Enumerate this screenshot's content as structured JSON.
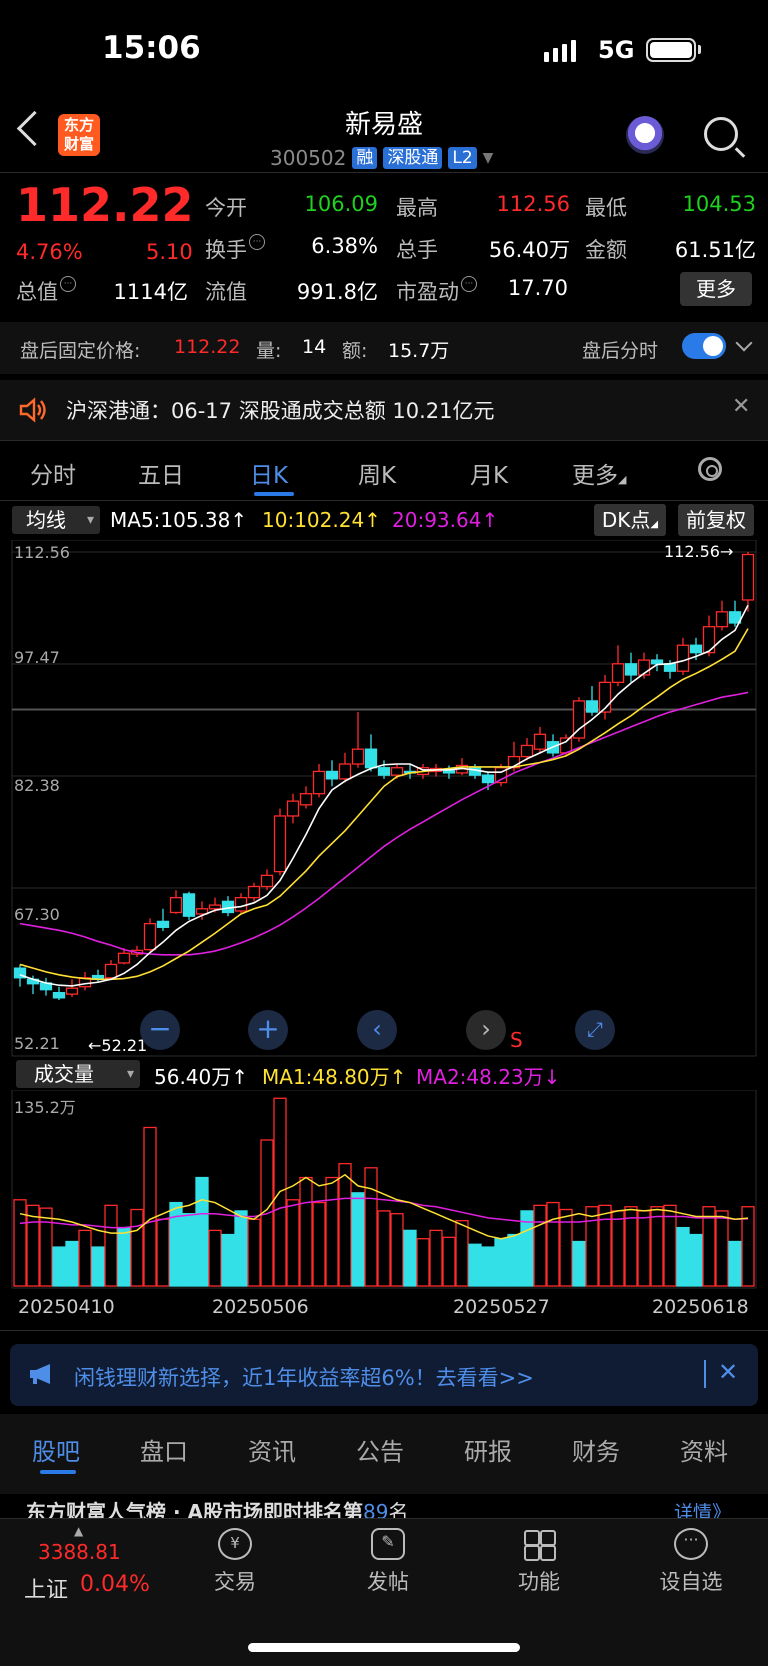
{
  "status_bar": {
    "time": "15:06",
    "network": "5G"
  },
  "header": {
    "logo_text": "东方财富",
    "stock_name": "新易盛",
    "stock_code": "300502",
    "tags": [
      "融",
      "深股通",
      "L2"
    ]
  },
  "quote": {
    "price": "112.22",
    "change_pct": "4.76%",
    "change": "5.10",
    "rows": [
      [
        {
          "label": "今开",
          "value": "106.09",
          "color": "#1fd11f"
        },
        {
          "label": "最高",
          "value": "112.56",
          "color": "#ff2a2a"
        },
        {
          "label": "最低",
          "value": "104.53",
          "color": "#1fd11f"
        }
      ],
      [
        {
          "label": "换手",
          "value": "6.38%",
          "color": "#ffffff"
        },
        {
          "label": "总手",
          "value": "56.40万",
          "color": "#ffffff"
        },
        {
          "label": "金额",
          "value": "61.51亿",
          "color": "#ffffff"
        }
      ],
      [
        {
          "label": "总值",
          "value": "1114亿",
          "color": "#ffffff"
        },
        {
          "label": "流值",
          "value": "991.8亿",
          "color": "#ffffff"
        },
        {
          "label": "市盈动",
          "value": "17.70",
          "color": "#ffffff"
        }
      ]
    ],
    "more_label": "更多"
  },
  "after_hours": {
    "price_label": "盘后固定价格:",
    "price": "112.22",
    "vol_label": "量:",
    "vol": "14",
    "amt_label": "额:",
    "amt": "15.7万",
    "toggle_label": "盘后分时"
  },
  "news": {
    "text": "沪深港通：06-17 深股通成交总额 10.21亿元"
  },
  "kline_tabs": [
    "分时",
    "五日",
    "日K",
    "周K",
    "月K",
    "更多"
  ],
  "ma_header": {
    "select": "均线",
    "ma5": "MA5:105.38↑",
    "ma10": "10:102.24↑",
    "ma20": "20:93.64↑",
    "dk_label": "DK点",
    "adjust_label": "前复权"
  },
  "chart_data": [
    {
      "type": "candlestick",
      "title": "",
      "y_ticks": [
        "112.56",
        "97.47",
        "82.38",
        "67.30",
        "52.21"
      ],
      "ylim": [
        52.21,
        112.56
      ],
      "max_label": "112.56→",
      "min_label": "←52.21",
      "candles": [
        [
          56.5,
          55.2,
          57.0,
          54.0
        ],
        [
          55.0,
          54.4,
          55.5,
          53.0
        ],
        [
          54.5,
          53.6,
          55.2,
          52.8
        ],
        [
          53.2,
          52.5,
          54.0,
          52.21
        ],
        [
          53.0,
          53.8,
          55.0,
          52.6
        ],
        [
          54.0,
          55.2,
          56.0,
          53.5
        ],
        [
          55.5,
          55.0,
          56.3,
          54.6
        ],
        [
          55.2,
          57.0,
          57.6,
          55.0
        ],
        [
          57.2,
          58.5,
          59.2,
          57.0
        ],
        [
          58.4,
          58.9,
          59.5,
          58.0
        ],
        [
          59.0,
          62.5,
          63.2,
          58.8
        ],
        [
          62.8,
          62.0,
          64.5,
          61.5
        ],
        [
          64.0,
          66.0,
          67.0,
          63.8
        ],
        [
          66.5,
          63.5,
          66.8,
          63.0
        ],
        [
          63.8,
          64.5,
          65.5,
          63.0
        ],
        [
          64.5,
          65.0,
          66.0,
          64.0
        ],
        [
          65.5,
          64.0,
          66.2,
          63.5
        ],
        [
          64.2,
          66.0,
          66.6,
          63.8
        ],
        [
          66.0,
          67.5,
          68.0,
          65.5
        ],
        [
          67.5,
          69.0,
          69.8,
          67.0
        ],
        [
          69.5,
          77.0,
          78.0,
          69.0
        ],
        [
          77.0,
          79.0,
          80.0,
          76.0
        ],
        [
          78.5,
          80.0,
          81.0,
          78.0
        ],
        [
          80.0,
          83.0,
          84.0,
          79.5
        ],
        [
          83.0,
          82.0,
          84.5,
          81.0
        ],
        [
          82.0,
          84.0,
          85.5,
          81.5
        ],
        [
          84.0,
          86.0,
          91.0,
          83.5
        ],
        [
          86.0,
          83.5,
          88.0,
          83.0
        ],
        [
          83.5,
          82.5,
          84.5,
          82.0
        ],
        [
          82.5,
          83.5,
          84.0,
          82.0
        ],
        [
          83.0,
          82.8,
          84.0,
          82.0
        ],
        [
          82.6,
          83.5,
          84.0,
          82.0
        ],
        [
          83.0,
          83.4,
          84.0,
          82.3
        ],
        [
          83.2,
          82.8,
          83.8,
          82.0
        ],
        [
          82.8,
          83.8,
          84.8,
          82.5
        ],
        [
          83.5,
          82.5,
          84.0,
          82.0
        ],
        [
          82.5,
          81.5,
          83.0,
          80.5
        ],
        [
          81.5,
          83.5,
          84.0,
          81.0
        ],
        [
          83.5,
          85.0,
          87.0,
          83.0
        ],
        [
          85.0,
          86.5,
          87.5,
          84.5
        ],
        [
          86.0,
          88.0,
          89.0,
          85.5
        ],
        [
          87.0,
          85.5,
          88.0,
          85.0
        ],
        [
          85.5,
          87.5,
          88.0,
          85.0
        ],
        [
          87.5,
          92.5,
          93.0,
          87.0
        ],
        [
          92.5,
          91.0,
          94.5,
          90.5
        ],
        [
          91.0,
          95.0,
          96.0,
          90.0
        ],
        [
          95.0,
          97.5,
          100.0,
          94.5
        ],
        [
          97.5,
          96.0,
          99.0,
          95.0
        ],
        [
          96.0,
          98.0,
          99.0,
          95.5
        ],
        [
          98.0,
          97.5,
          98.8,
          96.5
        ],
        [
          97.5,
          96.5,
          98.0,
          95.5
        ],
        [
          96.5,
          100.0,
          101.0,
          96.0
        ],
        [
          100.0,
          99.0,
          101.0,
          98.0
        ],
        [
          99.0,
          102.5,
          104.0,
          98.5
        ],
        [
          102.5,
          104.5,
          106.0,
          102.0
        ],
        [
          104.5,
          103.0,
          106.0,
          102.5
        ],
        [
          106.1,
          112.22,
          112.56,
          104.53
        ]
      ],
      "ma5": [
        55.6,
        55.0,
        54.5,
        54.2,
        54.1,
        54.4,
        54.6,
        55.0,
        55.8,
        57.0,
        58.6,
        60.0,
        61.6,
        62.8,
        63.6,
        64.3,
        64.6,
        64.8,
        65.3,
        66.3,
        68.3,
        71.3,
        74.5,
        78.0,
        80.5,
        81.7,
        82.6,
        83.4,
        83.9,
        84.0,
        84.0,
        83.2,
        83.2,
        83.2,
        83.4,
        83.2,
        82.9,
        82.9,
        83.7,
        84.7,
        85.5,
        86.3,
        87.0,
        88.7,
        90.0,
        91.5,
        93.4,
        94.9,
        96.2,
        97.4,
        97.5,
        97.9,
        98.5,
        99.2,
        100.8,
        102.0,
        105.38
      ],
      "ma10": [
        57.0,
        56.5,
        56.0,
        55.6,
        55.3,
        55.1,
        55.0,
        55.0,
        55.1,
        55.4,
        56.0,
        56.8,
        57.8,
        58.8,
        60.0,
        61.2,
        62.5,
        63.8,
        64.5,
        65.0,
        66.2,
        67.9,
        69.6,
        71.6,
        73.3,
        75.0,
        77.0,
        79.0,
        81.0,
        82.3,
        82.8,
        83.0,
        83.2,
        83.4,
        83.6,
        83.6,
        83.6,
        83.6,
        83.6,
        83.9,
        84.2,
        84.6,
        85.1,
        86.0,
        87.1,
        88.2,
        89.4,
        90.5,
        91.8,
        93.0,
        94.3,
        95.4,
        96.2,
        97.1,
        98.1,
        99.2,
        102.24
      ],
      "ma20": [
        62.5,
        62.2,
        61.9,
        61.6,
        61.2,
        60.7,
        60.1,
        59.6,
        59.0,
        58.6,
        58.4,
        58.3,
        58.3,
        58.3,
        58.5,
        58.8,
        59.3,
        59.9,
        60.6,
        61.4,
        62.3,
        63.4,
        64.6,
        65.9,
        67.3,
        68.7,
        70.1,
        71.5,
        72.9,
        74.1,
        75.2,
        76.2,
        77.2,
        78.2,
        79.2,
        80.1,
        81.0,
        81.9,
        82.8,
        83.5,
        84.2,
        84.8,
        85.5,
        86.2,
        86.9,
        87.6,
        88.3,
        89.0,
        89.7,
        90.4,
        91.0,
        91.5,
        92.0,
        92.5,
        93.0,
        93.3,
        93.64
      ]
    },
    {
      "type": "bar",
      "title": "",
      "series_labels": {
        "vol": "56.40万↑",
        "ma1": "MA1:48.80万↑",
        "ma2": "MA2:48.23万↓"
      },
      "y_max_label": "135.2万",
      "ylim": [
        0,
        135.2
      ],
      "x_ticks": [
        "20250410",
        "20250506",
        "20250527",
        "20250618"
      ],
      "volumes": [
        62,
        58,
        56,
        28,
        32,
        40,
        28,
        58,
        42,
        55,
        114,
        48,
        60,
        52,
        78,
        40,
        37,
        54,
        48,
        105,
        135,
        62,
        78,
        60,
        78,
        88,
        67,
        85,
        54,
        52,
        40,
        34,
        40,
        35,
        47,
        30,
        28,
        34,
        37,
        54,
        58,
        60,
        55,
        32,
        57,
        58,
        54,
        57,
        54,
        57,
        58,
        42,
        37,
        57,
        54,
        32,
        57
      ],
      "up": [
        1,
        1,
        1,
        0,
        0,
        1,
        0,
        1,
        0,
        1,
        1,
        1,
        0,
        0,
        0,
        1,
        0,
        0,
        1,
        1,
        1,
        1,
        1,
        1,
        1,
        1,
        0,
        1,
        1,
        1,
        0,
        1,
        1,
        1,
        1,
        0,
        0,
        0,
        0,
        0,
        1,
        1,
        1,
        0,
        1,
        1,
        1,
        1,
        1,
        1,
        1,
        0,
        0,
        1,
        1,
        0,
        1
      ],
      "ma1": [
        52,
        50,
        49,
        48,
        46,
        43,
        40,
        38,
        38,
        40,
        48,
        52,
        56,
        58,
        62,
        60,
        55,
        50,
        48,
        55,
        68,
        72,
        78,
        72,
        74,
        80,
        72,
        70,
        66,
        62,
        60,
        56,
        52,
        48,
        44,
        40,
        36,
        34,
        36,
        40,
        44,
        48,
        50,
        52,
        50,
        52,
        54,
        55,
        54,
        55,
        54,
        52,
        50,
        50,
        50,
        48,
        48.8
      ],
      "ma2": [
        45,
        46,
        46,
        45,
        44,
        44,
        43,
        42,
        42,
        43,
        46,
        48,
        50,
        51,
        52,
        52,
        51,
        50,
        50,
        52,
        56,
        58,
        60,
        61,
        62,
        63,
        63,
        63,
        62,
        61,
        60,
        58,
        57,
        55,
        53,
        51,
        49,
        48,
        47,
        46,
        46,
        46,
        46,
        46,
        47,
        48,
        48,
        49,
        49,
        50,
        50,
        50,
        49,
        49,
        49,
        48,
        48.23
      ]
    }
  ],
  "chart_nav": {
    "s_label": "S"
  },
  "ad": {
    "text": "闲钱理财新选择，近1年收益率超6%！去看看>>"
  },
  "bottom_tabs": [
    "股吧",
    "盘口",
    "资讯",
    "公告",
    "研报",
    "财务",
    "资料"
  ],
  "rank_row": {
    "text": "东方财富人气榜 · A股市场即时排名第",
    "rank": "89",
    "suffix": "名",
    "link": "详情》"
  },
  "bottom_nav": {
    "index_value": "3388.81",
    "index_name": "上证",
    "index_pct": "0.04%",
    "items": [
      {
        "label": "交易",
        "icon": "yen-cycle-icon"
      },
      {
        "label": "发帖",
        "icon": "edit-icon"
      },
      {
        "label": "功能",
        "icon": "grid-icon"
      },
      {
        "label": "设自选",
        "icon": "more-dots-icon"
      }
    ]
  }
}
